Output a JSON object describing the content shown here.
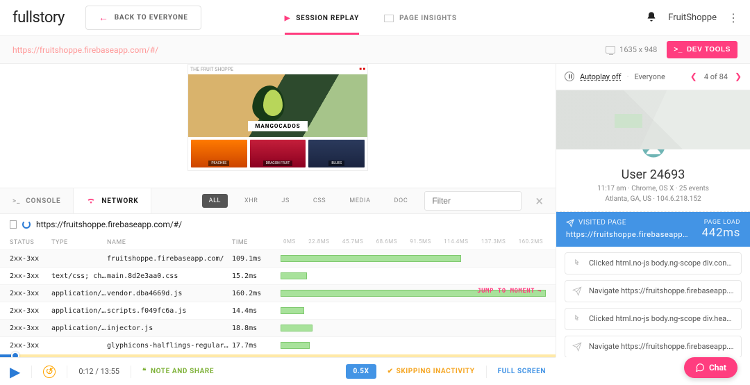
{
  "logo": "fullstory",
  "back_btn": "BACK TO EVERYONE",
  "top_tabs": {
    "replay": "SESSION REPLAY",
    "insights": "PAGE INSIGHTS"
  },
  "account": "FruitShoppe",
  "url": "https://fruitshoppe.firebaseapp.com/#/",
  "resolution": "1635 x 948",
  "devtools_btn": "DEV TOOLS",
  "hero_label": "MANGOCADOS",
  "site_brand": "THE FRUIT SHOPPE",
  "thumbs": [
    "PEACHES",
    "DRAGON FRUIT",
    "BLUES"
  ],
  "dt": {
    "console": "CONSOLE",
    "network": "NETWORK",
    "filters": [
      "ALL",
      "XHR",
      "JS",
      "CSS",
      "MEDIA",
      "DOC"
    ],
    "filter_placeholder": "Filter",
    "req_url": "https://fruitshoppe.firebaseapp.com/#/",
    "cols": {
      "status": "STATUS",
      "type": "TYPE",
      "name": "NAME",
      "time": "TIME"
    },
    "ticks": [
      "0ms",
      "22.8ms",
      "45.7ms",
      "68.6ms",
      "91.5ms",
      "114.4ms",
      "137.3ms",
      "160.2ms"
    ],
    "jump": "JUMP TO MOMENT",
    "rows": [
      {
        "status": "2xx-3xx",
        "type": "",
        "name": "fruitshoppe.firebaseapp.com/",
        "time": "109.1ms",
        "w": 68
      },
      {
        "status": "2xx-3xx",
        "type": "text/css; ch…",
        "name": "main.8d2e3aa0.css",
        "time": "15.2ms",
        "w": 10
      },
      {
        "status": "2xx-3xx",
        "type": "application/…",
        "name": "vendor.dba4669d.js",
        "time": "160.2ms",
        "w": 100
      },
      {
        "status": "2xx-3xx",
        "type": "application/…",
        "name": "scripts.f049fc6a.js",
        "time": "14.4ms",
        "w": 9
      },
      {
        "status": "2xx-3xx",
        "type": "application/…",
        "name": "injector.js",
        "time": "18.8ms",
        "w": 12
      },
      {
        "status": "2xx-3xx",
        "type": "",
        "name": "glyphicons-halflings-regular.wof",
        "time": "17.7ms",
        "w": 11
      }
    ]
  },
  "sidebar": {
    "autoplay": "Autoplay off",
    "everyone": "Everyone",
    "pos": "4 of 84",
    "user": "User 24693",
    "meta1": "11:17 am · Chrome, OS X · 25 events",
    "meta2": "Atlanta,  GA,  US · 104.6.218.152",
    "visited_label": "VISITED PAGE",
    "visited_url": "https://fruitshoppe.firebaseapp…",
    "pageload_label": "PAGE LOAD",
    "pageload_value": "442ms",
    "events": [
      {
        "kind": "click",
        "text": "Clicked html.no-js body.ng-scope div.cont…"
      },
      {
        "kind": "nav",
        "text": "Navigate https://fruitshoppe.firebaseapp.…"
      },
      {
        "kind": "click",
        "text": "Clicked html.no-js body.ng-scope div.head…"
      },
      {
        "kind": "nav",
        "text": "Navigate https://fruitshoppe.firebaseapp.…"
      }
    ]
  },
  "playbar": {
    "rewind": "7",
    "time": "0:12 / 13:55",
    "note": "NOTE AND SHARE",
    "speed": "0.5X",
    "skip": "SKIPPING INACTIVITY",
    "fullscreen": "FULL SCREEN"
  },
  "chat": "Chat"
}
